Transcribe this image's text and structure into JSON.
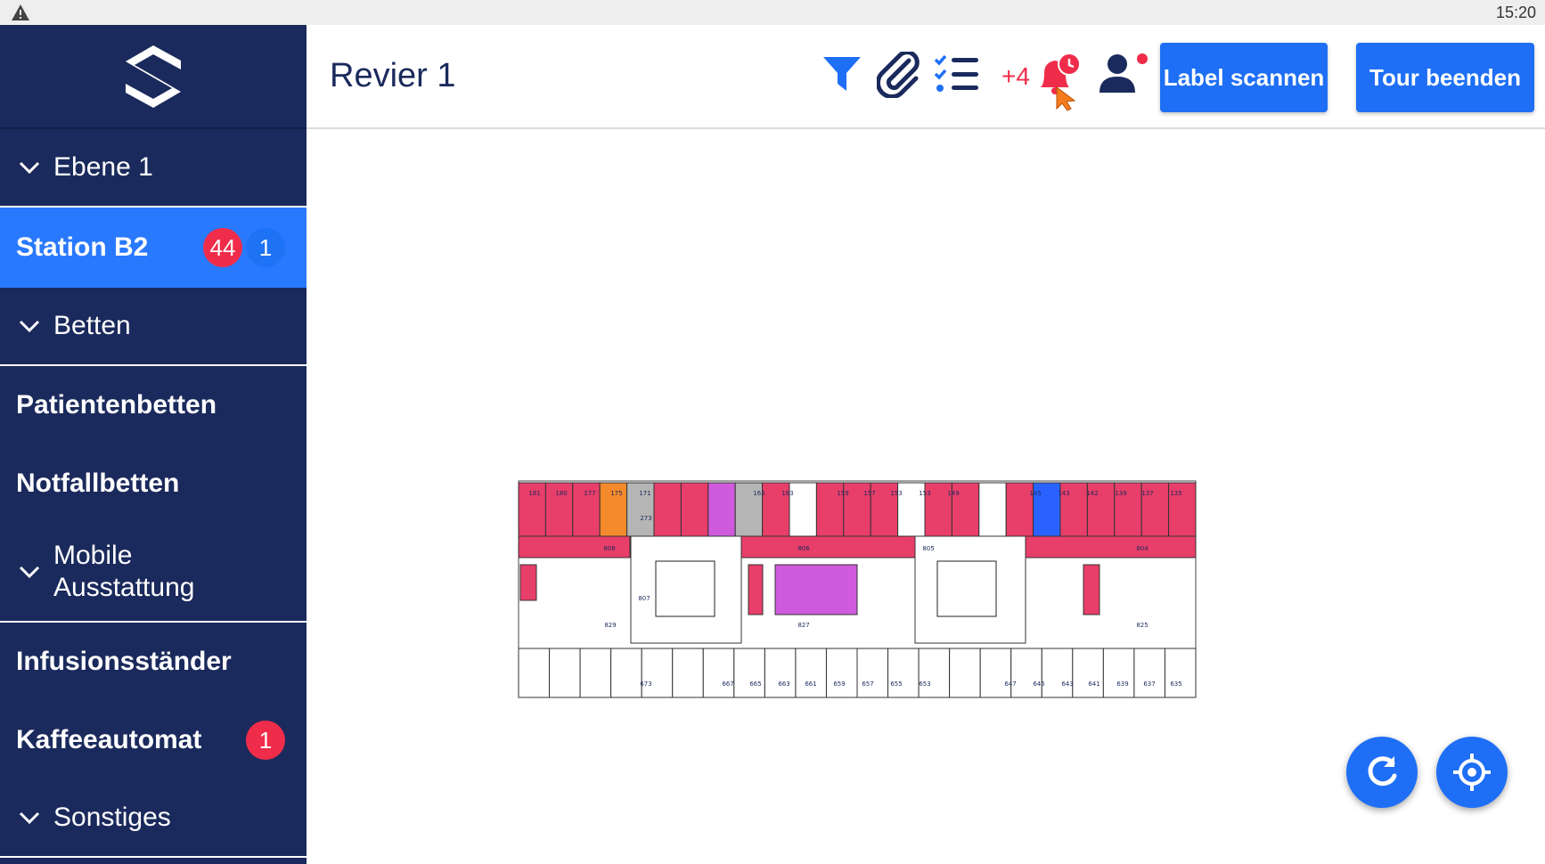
{
  "status": {
    "time": "15:20"
  },
  "header": {
    "title": "Revier 1",
    "notification_count": "+4",
    "scan_button": "Label scannen",
    "end_tour_button": "Tour beenden"
  },
  "sidebar": {
    "groups": [
      {
        "label": "Ebene 1"
      },
      {
        "label": "Betten"
      },
      {
        "label": "Mobile Ausstattung"
      },
      {
        "label": "Sonstiges"
      }
    ],
    "active_item": {
      "label": "Station B2",
      "badge_red": "44",
      "badge_blue": "1"
    },
    "items": [
      {
        "label": "Patientenbetten"
      },
      {
        "label": "Notfallbetten"
      },
      {
        "label": "Infusionsständer"
      },
      {
        "label": "Kaffeeautomat",
        "badge_red": "1"
      }
    ]
  },
  "floorplan": {
    "top_rooms": [
      "181",
      "180",
      "177",
      "175",
      "171",
      "165",
      "163",
      "159",
      "157",
      "153",
      "153",
      "149",
      "145",
      "143",
      "142",
      "139",
      "137",
      "135"
    ],
    "inner_labels": [
      "273",
      "808",
      "806",
      "805",
      "804",
      "807",
      "829",
      "827",
      "825"
    ],
    "bottom_rooms": [
      "673",
      "667",
      "665",
      "663",
      "661",
      "659",
      "657",
      "655",
      "653",
      "647",
      "645",
      "643",
      "641",
      "639",
      "637",
      "635"
    ]
  },
  "colors": {
    "sidebar": "#1b2a5c",
    "active": "#2979ff",
    "accent": "#1e6ff5",
    "alert": "#ef2d4a"
  }
}
